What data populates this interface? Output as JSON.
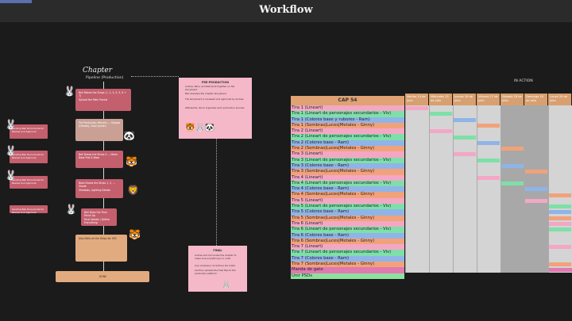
{
  "page_title": "Workflow",
  "pipeline": {
    "title": "Chapter",
    "subtitle": "Pipeline (Production)",
    "steps": [
      "Bell Makes the Strips (1, 2, 3, 4, 5, 6 + 7)",
      "Upload the Main Panels",
      "Pre-Production (Panels) — Shapes (Details), Color guides",
      "Bell Draws the Strips 4 — Maho",
      "Base Flat & Base",
      "Base Draws the Strips 1, 2, ... Shade",
      "Shadows, Lighting Details",
      "Bell Does the Final Finish Up",
      "Final Details / Define Everything",
      "Also Edits all the Strips for SFX",
      "DONE"
    ],
    "side_steps": [
      "Sending Bell Documents for Review and Approval",
      "Sending Bell Documents for Review and Approval",
      "Sending Bell Documents for Review and Approval",
      "Sending Bell Documents for Review and Approval"
    ],
    "pre_production": {
      "title": "PRE-PRODUCTION",
      "lines": [
        "Andrea, Wiku, and Ralf work together on the storyboard",
        "Bell develops the chapter storyboard",
        "The storyboard is reviewed and approved by Andrea",
        "Afterwards, Oscar organizes each production process"
      ]
    },
    "final": {
      "title": "FINAL",
      "lines": [
        "Andrea and Cai review the chapter to make sure everything is in order",
        "Any necessary corrections are made",
        "Cai then uploads the final files to the production platform"
      ]
    }
  },
  "timeline": {
    "in_action_label": "IN ACTION",
    "cap_label": "CAP 54",
    "days": [
      "Martes 14 de Julio",
      "Miércoles 15 de Julio",
      "Jueves 16 de Julio",
      "Viernes 17 de Julio",
      "Sábado 18 de Julio",
      "Domingo 19 de Julio",
      "Lunes 20 de Julio"
    ],
    "tasks": [
      "Tira 1 (Lineart)",
      "Tira 1 (Lineart de personajes secundarios - Viv)",
      "Tira 1 (Colores base y rubores - Ram)",
      "Tira 1 (Sombras|Luces|Metales - Ginny)",
      "Tira 2 (Lineart)",
      "Tira 2 (Lineart de personajes secundarios - Viv)",
      "Tira 2 (Colores base - Ram)",
      "Tira 2 (Sombras|Luces|Metales - Ginny)",
      "Tira 3 (Lineart)",
      "Tira 3 (Lineart de personajes secundarios - Viv)",
      "Tira 3 (Colores base - Ram)",
      "Tira 3 (Sombras|Luces|Metales - Ginny)",
      "Tira 4 (Lineart)",
      "Tira 4 (Lineart de personajes secundarios - Viv)",
      "Tira 4 (Colores base - Ram)",
      "Tira 4 (Sombras|Luces|Metales - Ginny)",
      "Tira 5 (Lineart)",
      "Tira 5 (Lineart de personajes secundarios - Viv)",
      "Tira 5 (Colores base - Ram)",
      "Tira 5 (Sombras|Luces|Metales - Ginny)",
      "Tira 6 (Lineart)",
      "Tira 6 (Lineart de personajes secundarios - Viv)",
      "Tira 6 (Colores base - Ram)",
      "Tira 6 (Sombras|Luces|Metales - Ginny)",
      "Tira 7 (Lineart)",
      "Tira 7 (Lineart de personajes secundarios - Viv)",
      "Tira 7 (Colores base - Ram)",
      "Tira 7 (Sombras|Luces|Metales - Ginny)",
      "Manda de gato",
      "Unir PSDs"
    ],
    "colors": {
      "lineart": "#f4a7c4",
      "secondary": "#7ee0a8",
      "base": "#8fb4e8",
      "shadows": "#f2a27a",
      "final": "#e07ab0",
      "psd": "#8fe0a0"
    }
  }
}
